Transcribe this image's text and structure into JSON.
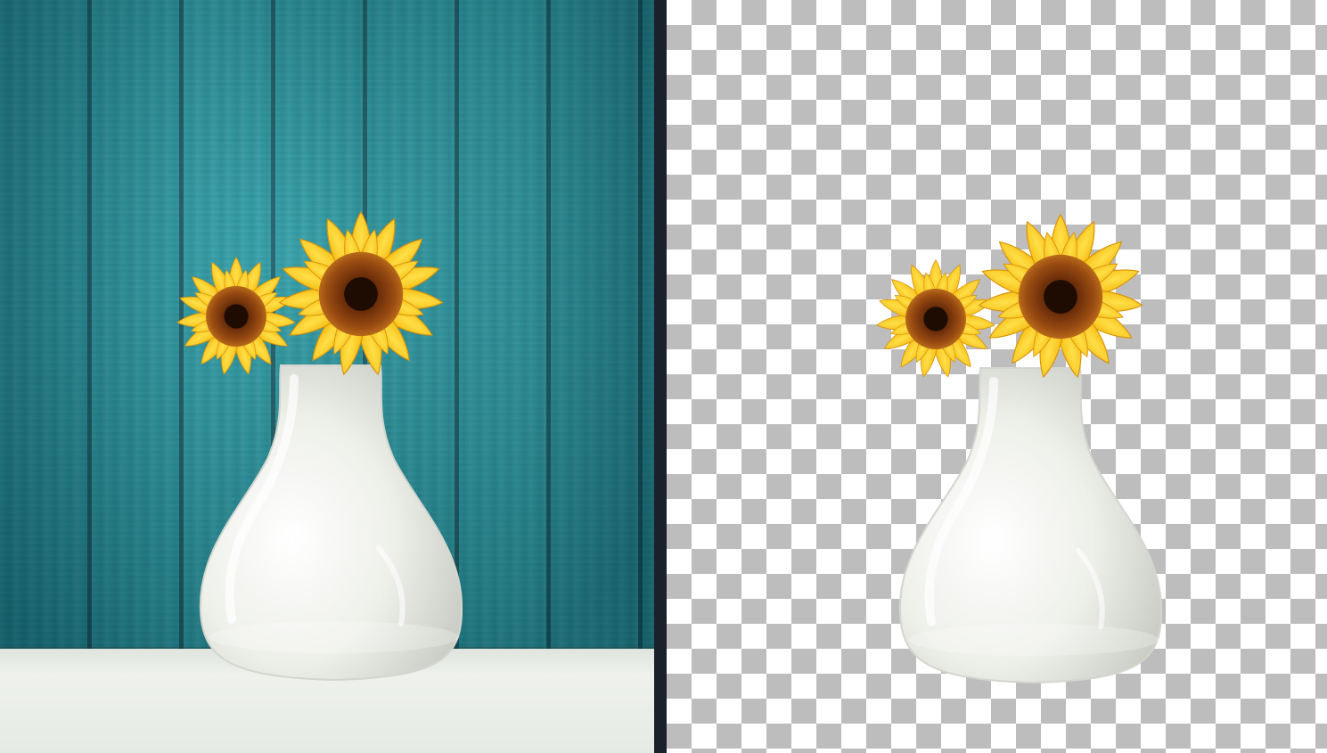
{
  "images": {
    "left": {
      "subject": "sunflowers-in-white-vase",
      "background": "teal-wood-wall"
    },
    "right": {
      "subject": "sunflowers-in-white-vase",
      "background": "transparent-checkerboard"
    }
  },
  "colors": {
    "wall": "#2aa2ac",
    "table": "#e8ece6",
    "divider": "#1a212b",
    "petal": "#f7c21a",
    "petal_dark": "#e8a30d",
    "seed_center": "#7a3a0e",
    "vase": "#f1f2ec",
    "checker_dark": "#bdbdbd",
    "checker_light": "#ffffff"
  }
}
